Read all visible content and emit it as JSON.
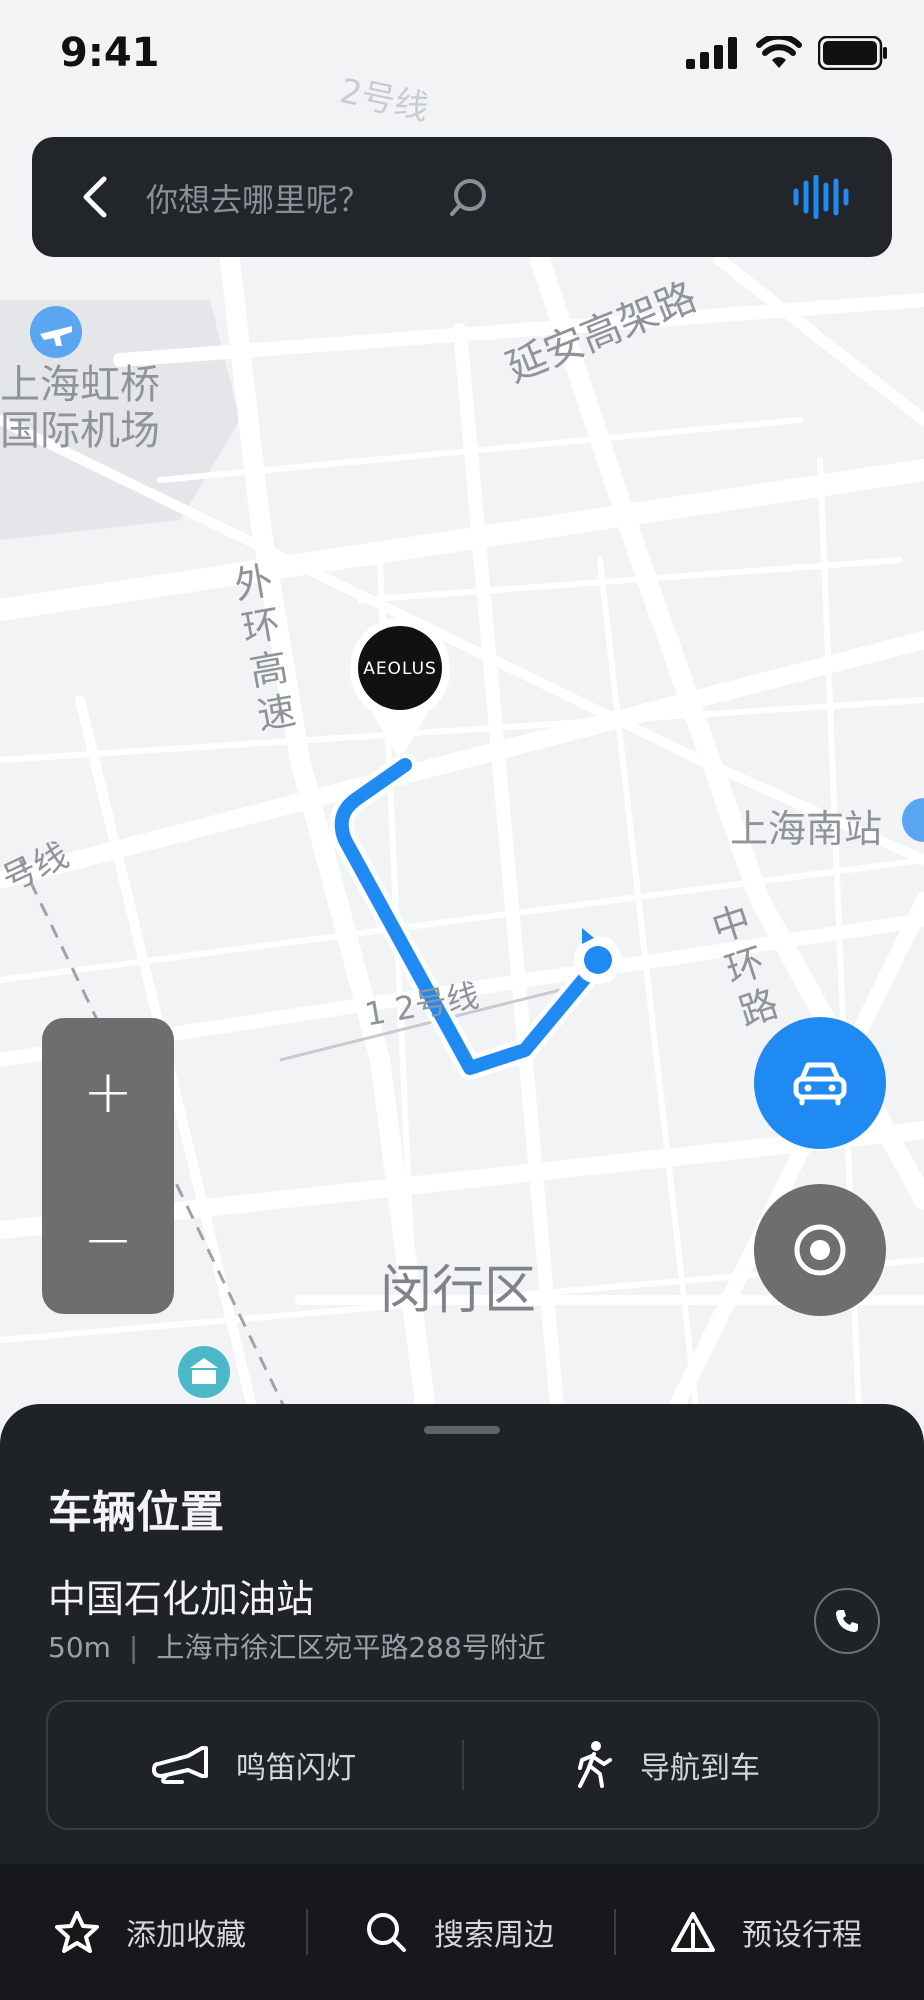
{
  "status_bar": {
    "time": "9:41"
  },
  "search": {
    "placeholder": "你想去哪里呢？"
  },
  "map": {
    "labels": {
      "road_metro2": "2号线",
      "road_yanan": "延安高架路",
      "airport": "上海虹桥\n国际机场",
      "ring_outer": "外\n环\n高\n速",
      "station_south": "上海南站",
      "metro_left": "号线",
      "metro_12": "1 2号线",
      "ring_middle": "中\n环\n路",
      "district": "闵行区"
    },
    "zoom": {
      "in_label": "+",
      "out_label": "−"
    },
    "brand_logo_text": "AEOLUS",
    "route_color": "#1f8af2"
  },
  "sheet": {
    "title": "车辆位置",
    "place_name": "中国石化加油站",
    "distance": "50m",
    "separator": "|",
    "address": "上海市徐汇区宛平路288号附近",
    "actions": {
      "horn_label": "鸣笛闪灯",
      "nav_label": "导航到车"
    }
  },
  "bottom_bar": {
    "favorite_label": "添加收藏",
    "nearby_label": "搜索周边",
    "trip_label": "预设行程"
  },
  "colors": {
    "accent": "#1f8af2",
    "panel": "#1f2226",
    "search_bg": "#22262b"
  }
}
